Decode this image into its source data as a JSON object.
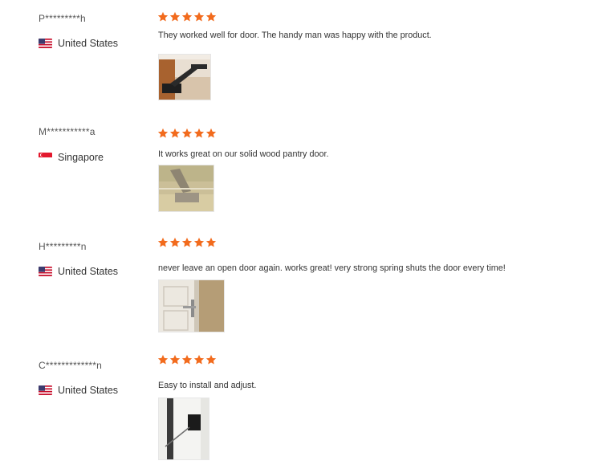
{
  "reviews": [
    {
      "reviewer": "P*********h",
      "country": "United States",
      "flag_icon": "us-flag-icon",
      "rating": 5,
      "text": "They worked well for door. The handy man was happy with the product."
    },
    {
      "reviewer": "M***********a",
      "country": "Singapore",
      "flag_icon": "singapore-flag-icon",
      "rating": 5,
      "text": "It works great on our solid wood pantry door."
    },
    {
      "reviewer": "H*********n",
      "country": "United States",
      "flag_icon": "us-flag-icon",
      "rating": 5,
      "text": "never leave an open door again. works great! very strong spring shuts the door every time!"
    },
    {
      "reviewer": "C*************n",
      "country": "United States",
      "flag_icon": "us-flag-icon",
      "rating": 5,
      "text": "Easy to install and adjust."
    }
  ],
  "colors": {
    "star": "#f26b1d",
    "text": "#333333",
    "name": "#555555"
  }
}
